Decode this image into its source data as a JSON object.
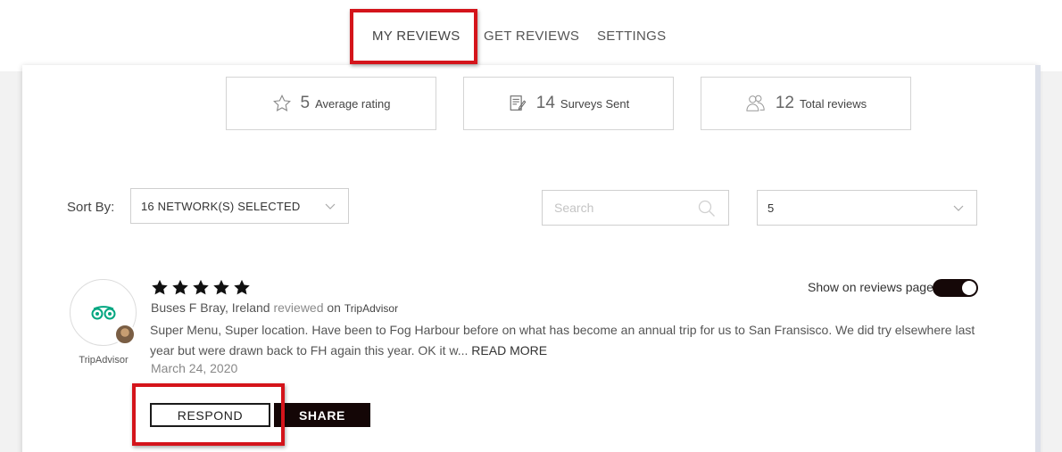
{
  "tabs": [
    {
      "label": "MY REVIEWS",
      "active": true
    },
    {
      "label": "GET REVIEWS",
      "active": false
    },
    {
      "label": "SETTINGS",
      "active": false
    }
  ],
  "stats": [
    {
      "value": "5",
      "label": "Average rating",
      "icon": "star-outline-icon"
    },
    {
      "value": "14",
      "label": "Surveys Sent",
      "icon": "survey-document-icon"
    },
    {
      "value": "12",
      "label": "Total reviews",
      "icon": "users-icon"
    }
  ],
  "filters": {
    "sort_label": "Sort By:",
    "network_select": "16 NETWORK(S) SELECTED",
    "search_placeholder": "Search",
    "search_value": "",
    "count_select": "5"
  },
  "review": {
    "rating": 5,
    "source_logo_label": "TripAdvisor",
    "reviewer_name": "Buses F Bray, Ireland",
    "reviewed_word": "reviewed",
    "on_word": "on",
    "network": "TripAdvisor",
    "text": "Super Menu, Super location. Have been to Fog Harbour before on what has become an annual trip for us to San Fransisco. We did try elsewhere last year but were drawn back to FH again this year. OK it w...",
    "read_more": "READ MORE",
    "date": "March 24, 2020",
    "show_on_page_label": "Show on reviews page",
    "show_on_page": true,
    "respond_label": "RESPOND",
    "share_label": "SHARE"
  },
  "colors": {
    "highlight": "#d4141b",
    "dark_button": "#140606",
    "tripadvisor_green": "#00a680"
  }
}
